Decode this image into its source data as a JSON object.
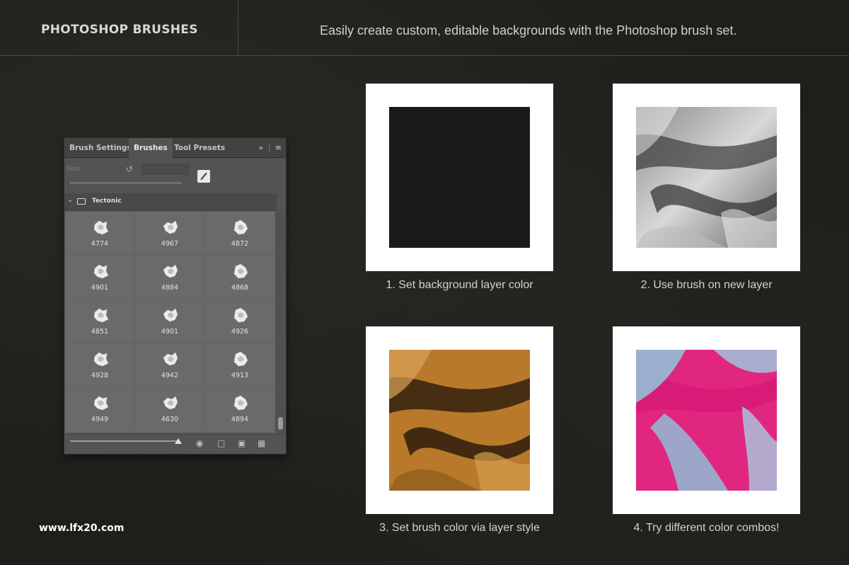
{
  "header": {
    "title": "PHOTOSHOP BRUSHES",
    "tagline": "Easily create custom, editable backgrounds with the Photoshop brush set."
  },
  "panel": {
    "tabs": [
      {
        "label": "Brush Settings",
        "active": false
      },
      {
        "label": "Brushes",
        "active": true
      },
      {
        "label": "Tool Presets",
        "active": false
      }
    ],
    "size_label": "Size:",
    "group_name": "Tectonic",
    "brushes": [
      "4774",
      "4967",
      "4872",
      "4901",
      "4884",
      "4868",
      "4851",
      "4901",
      "4926",
      "4928",
      "4942",
      "4913",
      "4949",
      "4630",
      "4894"
    ],
    "icons": {
      "overflow": "double-chevron-right-icon",
      "menu": "hamburger-menu-icon",
      "reset": "reset-icon",
      "new_brush": "new-brush-icon",
      "chevron": "chevron-down-icon",
      "folder": "folder-icon",
      "visibility": "eye-icon",
      "new_group": "folder-icon",
      "new_preset": "new-preset-icon",
      "delete": "trash-icon"
    }
  },
  "steps": [
    {
      "caption": "1. Set background layer color",
      "fill": "#1a191b"
    },
    {
      "caption": "2. Use brush on new layer"
    },
    {
      "caption": "3. Set brush color via layer style"
    },
    {
      "caption": "4. Try different color combos!"
    }
  ],
  "footer": {
    "url": "www.lfx20.com"
  }
}
